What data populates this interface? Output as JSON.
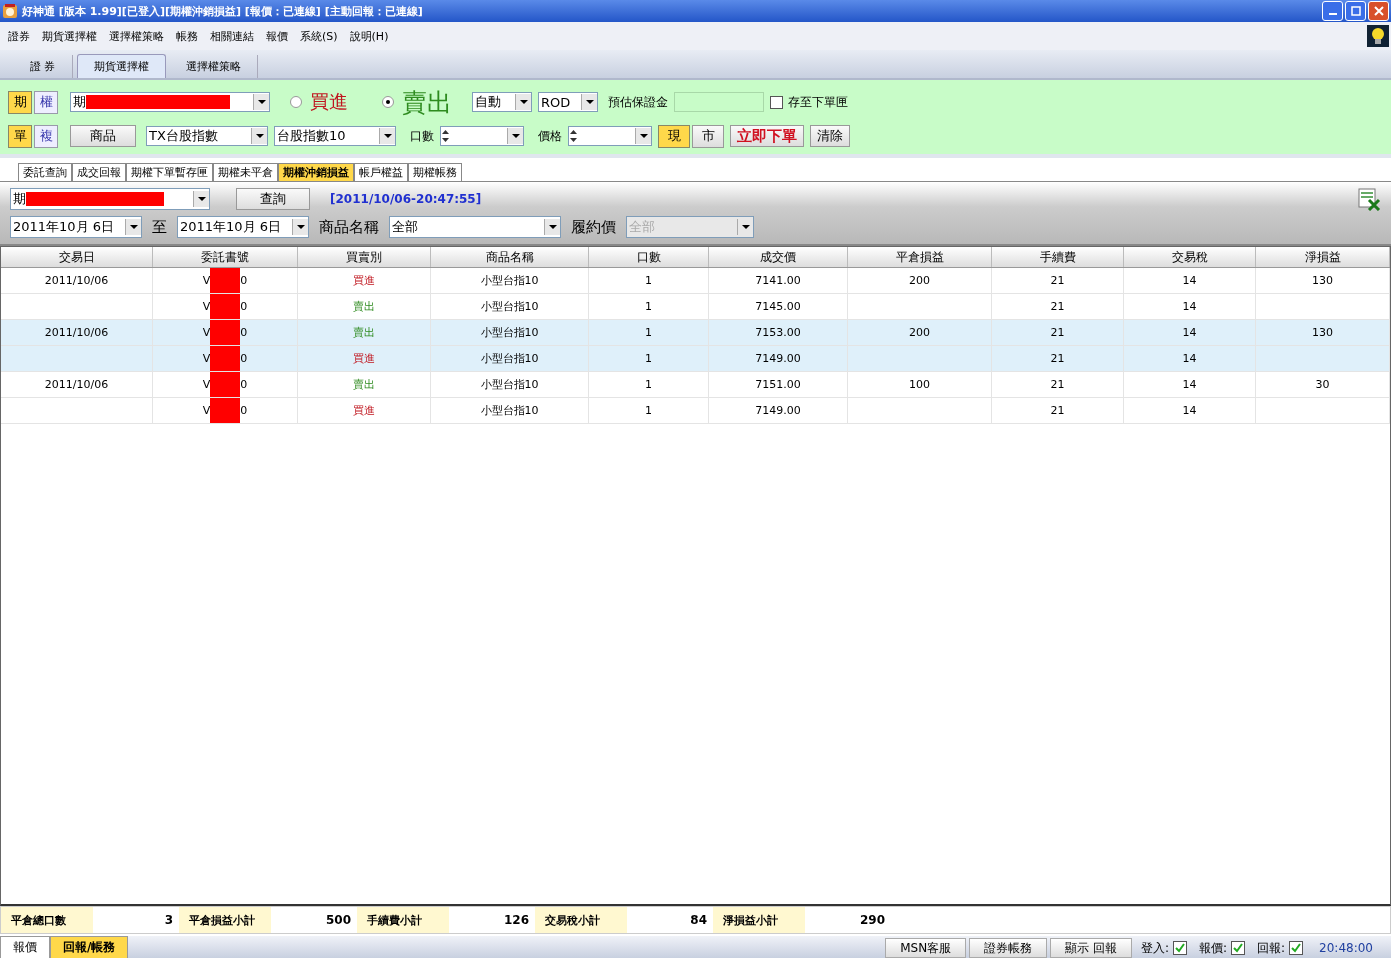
{
  "window": {
    "title": "好神通 [版本 1.99][已登入][期權沖銷損益] [報價：已連線] [主動回報：已連線]"
  },
  "menu": [
    "證券",
    "期貨選擇權",
    "選擇權策略",
    "帳務",
    "相關連結",
    "報價",
    "系統(S)",
    "說明(H)"
  ],
  "main_tabs": [
    {
      "label": "證 券",
      "selected": false
    },
    {
      "label": "期貨選擇權",
      "selected": true
    },
    {
      "label": "選擇權策略",
      "selected": false
    }
  ],
  "order_panel": {
    "market_toggle": [
      {
        "label": "期",
        "selected": true
      },
      {
        "label": "權",
        "selected": false
      }
    ],
    "account": {
      "value": "期",
      "redacted": true
    },
    "sides": [
      {
        "label": "買進",
        "kind": "buy",
        "selected": false
      },
      {
        "label": "賣出",
        "kind": "sell",
        "selected": true
      }
    ],
    "mode": "自動",
    "duration": "ROD",
    "margin_label": "預估保證金",
    "save_to_box": {
      "label": "存至下單匣",
      "checked": false
    },
    "order_toggle": [
      {
        "label": "單",
        "selected": true
      },
      {
        "label": "複",
        "selected": false
      }
    ],
    "product_button": "商品",
    "product": "TX台股指數",
    "contract": "台股指數10",
    "qty_label": "口數",
    "price_label": "價格",
    "price_type": [
      {
        "label": "現",
        "selected": true
      },
      {
        "label": "市",
        "selected": false
      }
    ],
    "submit": "立即下單",
    "clear": "清除"
  },
  "sub_tabs": [
    {
      "label": "委託查詢",
      "selected": false
    },
    {
      "label": "成交回報",
      "selected": false
    },
    {
      "label": "期權下單暫存匣",
      "selected": false
    },
    {
      "label": "期權未平倉",
      "selected": false
    },
    {
      "label": "期權沖銷損益",
      "selected": true
    },
    {
      "label": "帳戶權益",
      "selected": false
    },
    {
      "label": "期權帳務",
      "selected": false
    }
  ],
  "filter": {
    "account": {
      "value": "期",
      "redacted": true
    },
    "query_button": "查詢",
    "timestamp": "[2011/10/06-20:47:55]",
    "date_from": "2011年10月  6日",
    "to_label": "至",
    "date_to": "2011年10月  6日",
    "product_label": "商品名稱",
    "product": "全部",
    "strike_label": "履約價",
    "strike": "全部",
    "strike_disabled": true
  },
  "table": {
    "columns": [
      "交易日",
      "委託書號",
      "買賣別",
      "商品名稱",
      "口數",
      "成交價",
      "平倉損益",
      "手續費",
      "交易稅",
      "淨損益"
    ],
    "rows": [
      {
        "highlighted": false,
        "date": "2011/10/06",
        "order_head": "V",
        "order_tail": "0",
        "side": {
          "text": "買進",
          "kind": "buy"
        },
        "product": "小型台指10",
        "qty": "1",
        "price": "7141.00",
        "pl": "200",
        "fee": "21",
        "tax": "14",
        "net": "130"
      },
      {
        "highlighted": false,
        "date": "",
        "order_head": "V",
        "order_tail": "0",
        "side": {
          "text": "賣出",
          "kind": "sell"
        },
        "product": "小型台指10",
        "qty": "1",
        "price": "7145.00",
        "pl": "",
        "fee": "21",
        "tax": "14",
        "net": ""
      },
      {
        "highlighted": true,
        "date": "2011/10/06",
        "order_head": "V",
        "order_tail": "0",
        "side": {
          "text": "賣出",
          "kind": "sell"
        },
        "product": "小型台指10",
        "qty": "1",
        "price": "7153.00",
        "pl": "200",
        "fee": "21",
        "tax": "14",
        "net": "130"
      },
      {
        "highlighted": true,
        "date": "",
        "order_head": "V",
        "order_tail": "0",
        "side": {
          "text": "買進",
          "kind": "buy"
        },
        "product": "小型台指10",
        "qty": "1",
        "price": "7149.00",
        "pl": "",
        "fee": "21",
        "tax": "14",
        "net": ""
      },
      {
        "highlighted": false,
        "date": "2011/10/06",
        "order_head": "V",
        "order_tail": "0",
        "side": {
          "text": "賣出",
          "kind": "sell"
        },
        "product": "小型台指10",
        "qty": "1",
        "price": "7151.00",
        "pl": "100",
        "fee": "21",
        "tax": "14",
        "net": "30"
      },
      {
        "highlighted": false,
        "date": "",
        "order_head": "V",
        "order_tail": "0",
        "side": {
          "text": "買進",
          "kind": "buy"
        },
        "product": "小型台指10",
        "qty": "1",
        "price": "7149.00",
        "pl": "",
        "fee": "21",
        "tax": "14",
        "net": ""
      }
    ]
  },
  "summary": [
    {
      "label": "平倉總口數",
      "value": "3"
    },
    {
      "label": "平倉損益小計",
      "value": "500"
    },
    {
      "label": "手續費小計",
      "value": "126"
    },
    {
      "label": "交易稅小計",
      "value": "84"
    },
    {
      "label": "淨損益小計",
      "value": "290"
    }
  ],
  "status_bar": {
    "tabs": [
      {
        "label": "報價",
        "selected": false
      },
      {
        "label": "回報/帳務",
        "selected": true
      }
    ],
    "buttons": [
      "MSN客服",
      "證券帳務",
      "顯示 回報"
    ],
    "indicators": [
      {
        "label": "登入:",
        "checked": true
      },
      {
        "label": "報價:",
        "checked": true
      },
      {
        "label": "回報:",
        "checked": true
      }
    ],
    "time": "20:48:00"
  }
}
